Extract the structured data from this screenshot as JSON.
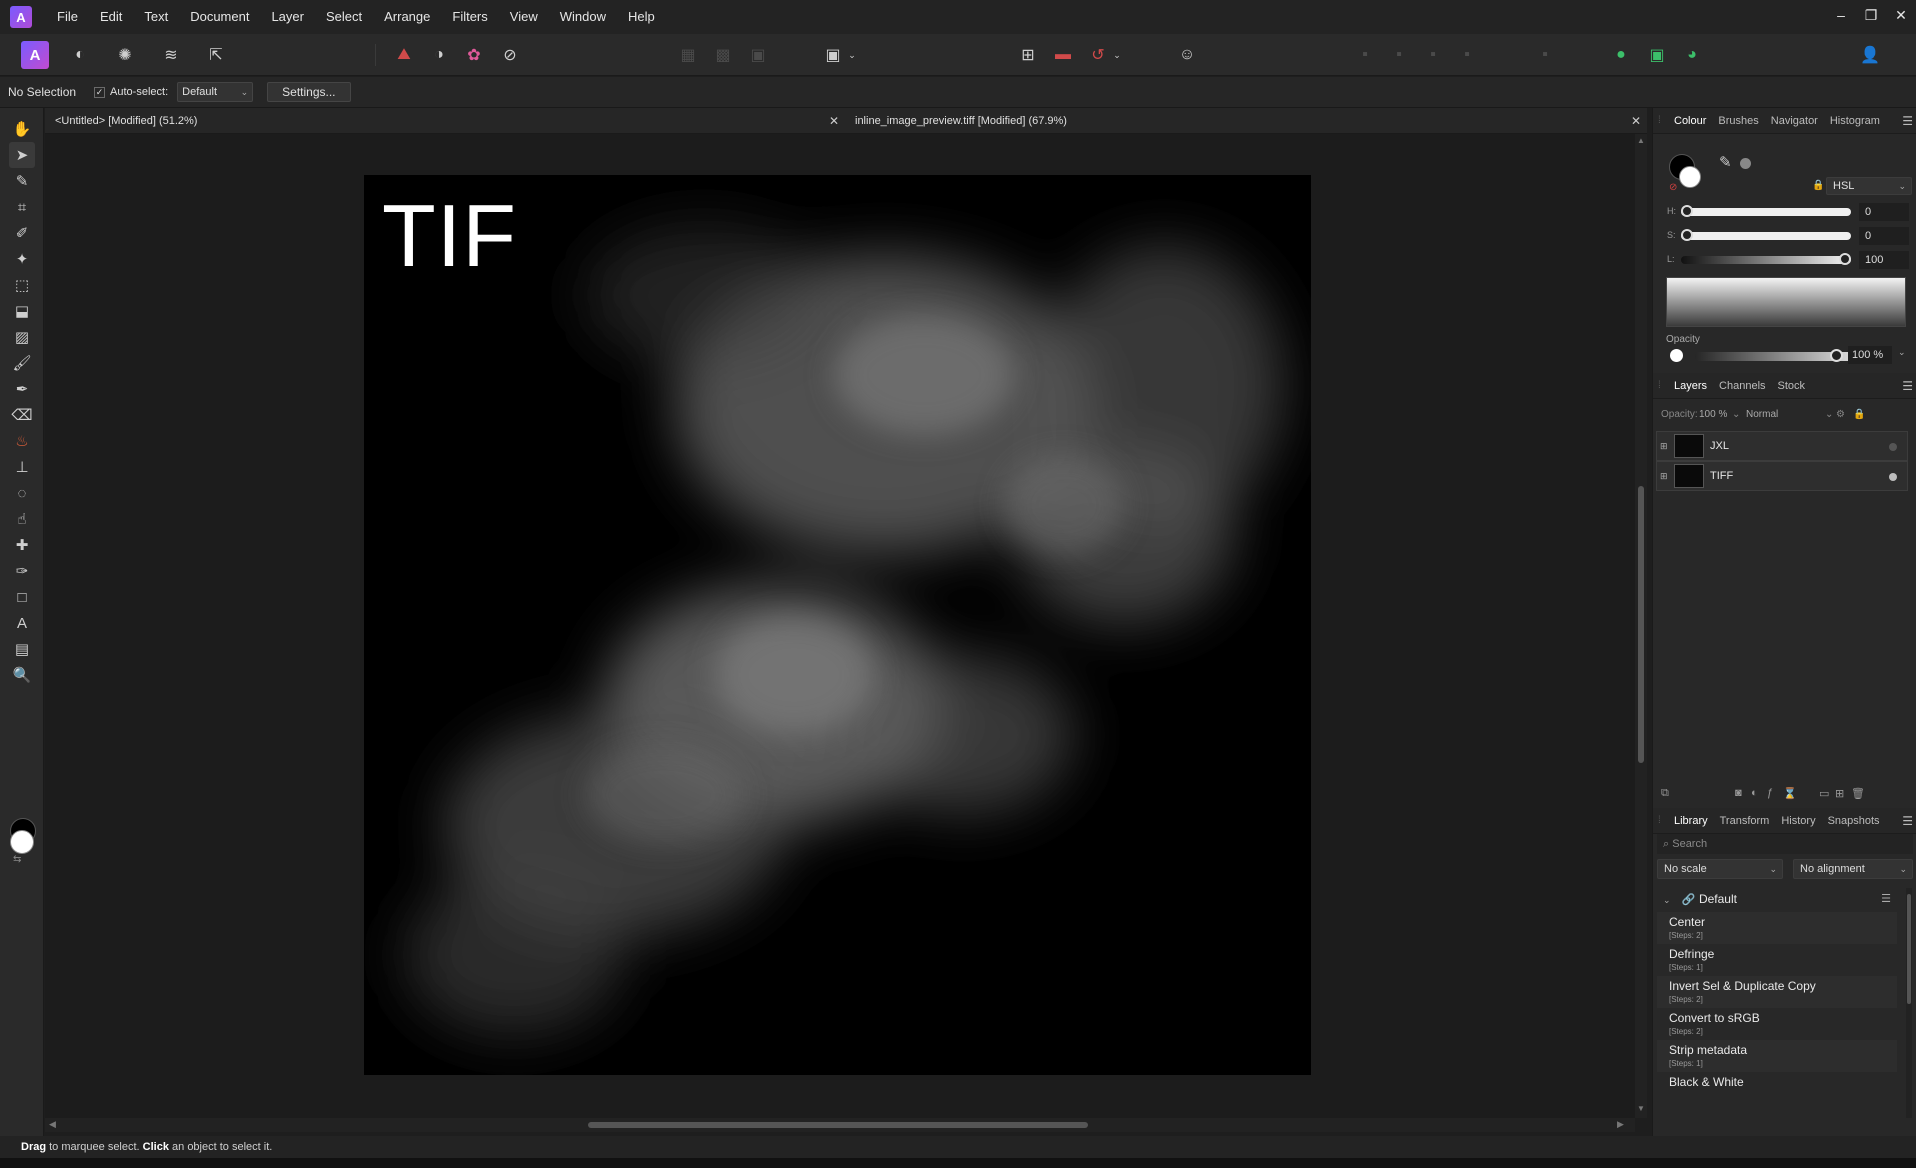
{
  "menubar": {
    "items": [
      "File",
      "Edit",
      "Text",
      "Document",
      "Layer",
      "Select",
      "Arrange",
      "Filters",
      "View",
      "Window",
      "Help"
    ],
    "window_controls": [
      "–",
      "❐",
      "✕"
    ]
  },
  "toolbar": {
    "persona_icon": "affinity-photo-persona-icon",
    "icons": [
      "liquify-persona-icon",
      "develop-persona-icon",
      "tone-mapping-persona-icon",
      "export-persona-icon",
      "warp-icon",
      "mask-icon",
      "color-wheel-icon",
      "quick-mask-icon",
      "marquee-options-icon",
      "snapping-icon",
      "align-icon",
      "assistant-icon",
      "user-account-icon"
    ]
  },
  "context": {
    "selection_label": "No Selection",
    "autoselect_label": "Auto-select:",
    "autoselect_checked": true,
    "autoselect_value": "Default",
    "settings_label": "Settings..."
  },
  "tools": [
    "view-tool-icon",
    "move-tool-icon",
    "color-picker-tool-icon",
    "crop-tool-icon",
    "selection-brush-icon",
    "flood-select-icon",
    "marquee-tool-icon",
    "flood-fill-icon",
    "gradient-tool-icon",
    "paint-brush-icon",
    "color-replacement-icon",
    "erase-brush-icon",
    "dodge-brush-icon",
    "clone-brush-icon",
    "blur-brush-icon",
    "smudge-brush-icon",
    "inpainting-brush-icon",
    "pen-tool-icon",
    "rectangle-tool-icon",
    "artistic-text-icon",
    "mesh-warp-icon",
    "zoom-tool-icon"
  ],
  "documents": {
    "tab1": "<Untitled> [Modified] (51.2%)",
    "tab2": "inline_image_preview.tiff [Modified] (67.9%)"
  },
  "canvas": {
    "overlay_text": "TIF"
  },
  "status": {
    "drag": "Drag",
    "drag_rest": " to marquee select. ",
    "click": "Click",
    "click_rest": " an object to select it."
  },
  "panels": {
    "color": {
      "tabs": [
        "Colour",
        "Brushes",
        "Navigator",
        "Histogram"
      ],
      "mode": "HSL",
      "h_label": "H:",
      "h_value": "0",
      "s_label": "S:",
      "s_value": "0",
      "l_label": "L:",
      "l_value": "100",
      "opacity_label": "Opacity",
      "opacity_value": "100 %",
      "foreground": "#000000",
      "background": "#ffffff"
    },
    "layers": {
      "tabs": [
        "Layers",
        "Channels",
        "Stock"
      ],
      "opacity_label": "Opacity:",
      "opacity_value": "100 %",
      "blend_mode": "Normal",
      "items": [
        {
          "name": "JXL",
          "visible": false
        },
        {
          "name": "TIFF",
          "visible": true
        }
      ]
    },
    "library": {
      "tabs": [
        "Library",
        "Transform",
        "History",
        "Snapshots"
      ],
      "search_placeholder": "Search",
      "scale": "No scale",
      "alignment": "No alignment",
      "group": "Default",
      "macros": [
        {
          "name": "Center",
          "steps": "[Steps: 2]"
        },
        {
          "name": "Defringe",
          "steps": "[Steps: 1]"
        },
        {
          "name": "Invert Sel & Duplicate Copy",
          "steps": "[Steps: 2]"
        },
        {
          "name": "Convert to sRGB",
          "steps": "[Steps: 2]"
        },
        {
          "name": "Strip metadata",
          "steps": "[Steps: 1]"
        },
        {
          "name": "Black & White",
          "steps": ""
        }
      ]
    }
  },
  "colors": {
    "accent": "#7a5cff",
    "panel_bg": "#282828",
    "canvas_bg": "#1c1c1c"
  }
}
